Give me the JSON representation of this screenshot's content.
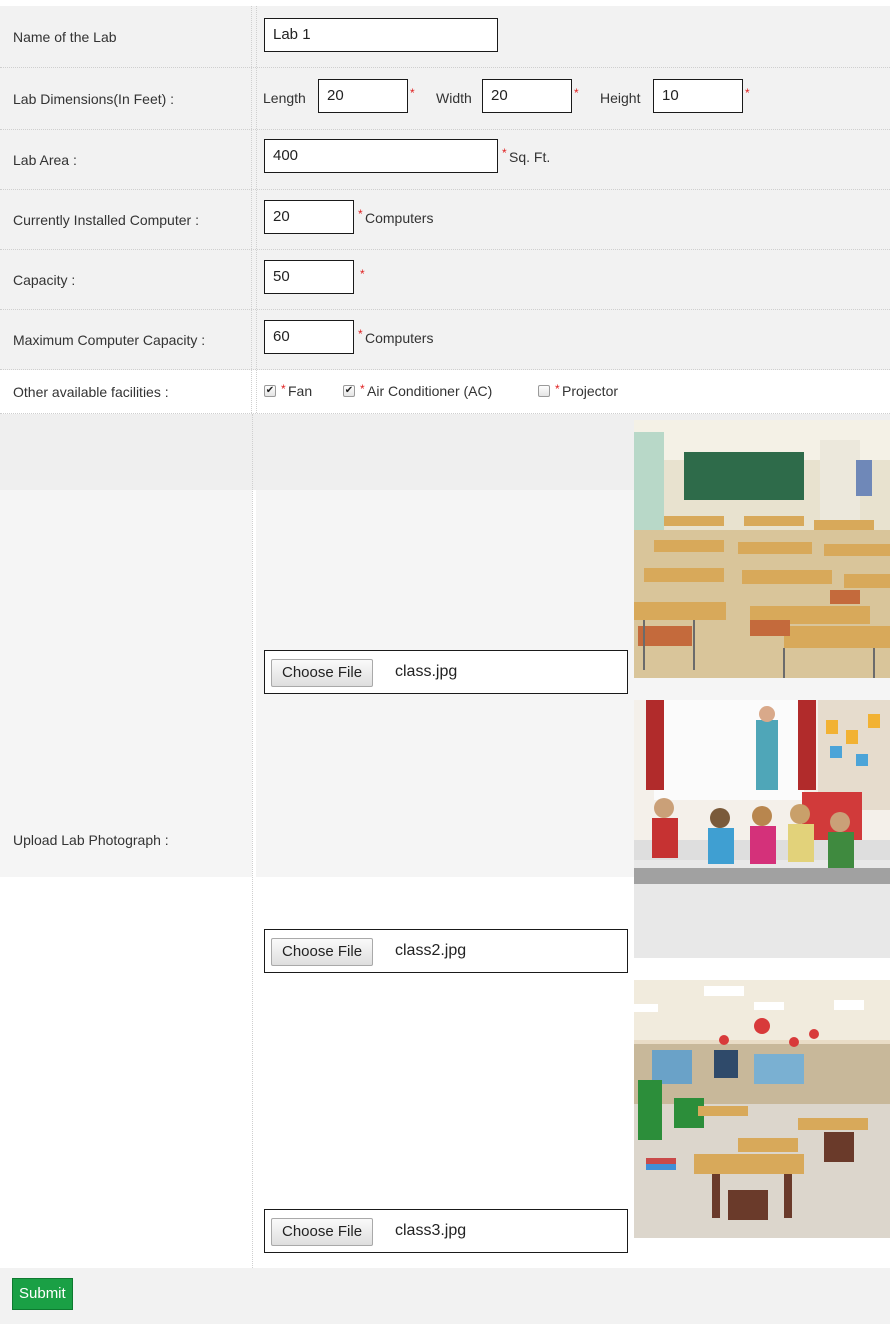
{
  "form": {
    "name": {
      "label": "Name of the Lab",
      "value": "Lab 1"
    },
    "dimensions": {
      "label": "Lab Dimensions(In Feet) :",
      "length_label": "Length",
      "length_value": "20",
      "width_label": "Width",
      "width_value": "20",
      "height_label": "Height",
      "height_value": "10"
    },
    "area": {
      "label": "Lab Area :",
      "value": "400",
      "unit": "Sq. Ft."
    },
    "installed": {
      "label": "Currently Installed Computer :",
      "value": "20",
      "unit": "Computers"
    },
    "capacity": {
      "label": "Capacity :",
      "value": "50"
    },
    "max_capacity": {
      "label": "Maximum Computer Capacity :",
      "value": "60",
      "unit": "Computers"
    },
    "facilities": {
      "label": "Other available facilities :",
      "items": [
        {
          "label": "Fan",
          "checked": true
        },
        {
          "label": "Air Conditioner (AC)",
          "checked": true
        },
        {
          "label": "Projector",
          "checked": false
        }
      ]
    },
    "photos": {
      "label": "Upload Lab Photograph :",
      "button_label": "Choose File",
      "files": [
        "class.jpg",
        "class2.jpg",
        "class3.jpg"
      ]
    },
    "required_mark": "*",
    "check_mark": "✔",
    "submit_label": "Submit"
  },
  "colors": {
    "submit": "#1aa045",
    "required": "#e02020",
    "stripe": "#f2f2f2"
  }
}
